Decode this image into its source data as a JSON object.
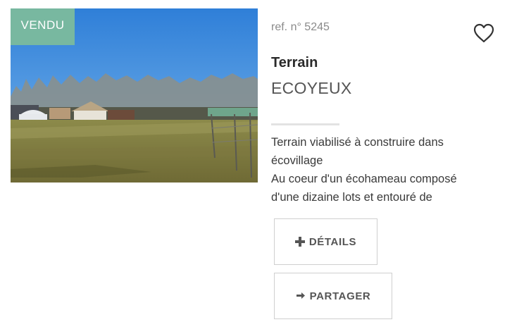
{
  "listing": {
    "status_badge": "VENDU",
    "reference": "ref. n° 5245",
    "property_type": "Terrain",
    "city": "ECOYEUX",
    "description_lines": [
      "Terrain viabilisé à construire dans",
      "écovillage",
      "Au coeur d'un écohameau composé",
      "d'une dizaine lots et entouré de"
    ],
    "details_label": "DÉTAILS",
    "share_label": "PARTAGER"
  },
  "colors": {
    "badge": "#78b8a0",
    "text": "#333333",
    "muted": "#8a8a8a"
  },
  "icons": {
    "favorite": "heart-outline-icon",
    "details": "plus-icon",
    "share": "arrow-right-icon"
  }
}
